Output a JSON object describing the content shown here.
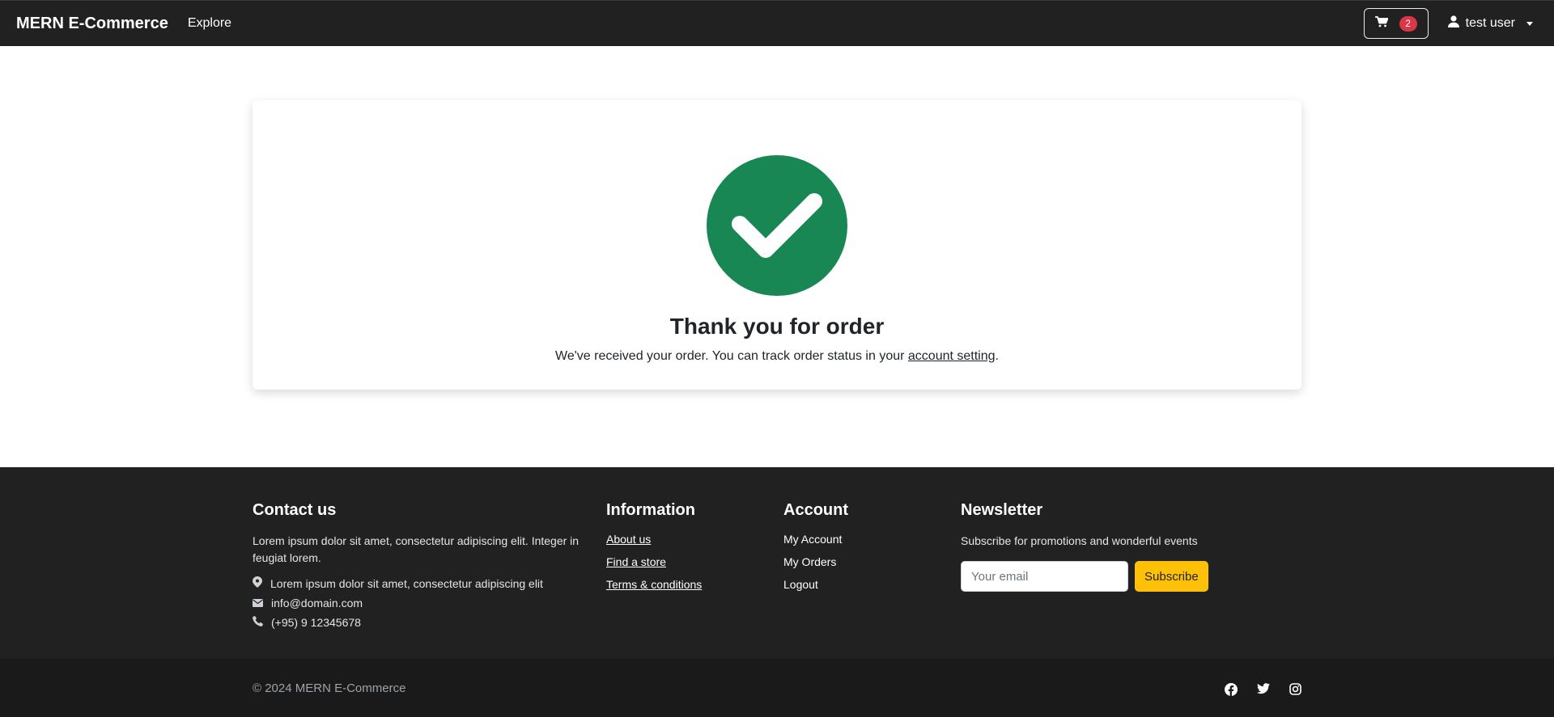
{
  "navbar": {
    "brand": "MERN E-Commerce",
    "explore": "Explore",
    "cart_count": "2",
    "user_name": "test user"
  },
  "confirmation": {
    "title": "Thank you for order",
    "message_prefix": "We've received your order. You can track order status in your ",
    "link_text": "account setting",
    "message_suffix": "."
  },
  "footer": {
    "contact": {
      "heading": "Contact us",
      "description": "Lorem ipsum dolor sit amet, consectetur adipiscing elit. Integer in feugiat lorem.",
      "address": "Lorem ipsum dolor sit amet, consectetur adipiscing elit",
      "email": "info@domain.com",
      "phone": "(+95) 9 12345678"
    },
    "information": {
      "heading": "Information",
      "links": [
        "About us",
        "Find a store",
        "Terms & conditions"
      ]
    },
    "account": {
      "heading": "Account",
      "links": [
        "My Account",
        "My Orders",
        "Logout"
      ]
    },
    "newsletter": {
      "heading": "Newsletter",
      "text": "Subscribe for promotions and wonderful events",
      "placeholder": "Your email",
      "button": "Subscribe"
    },
    "copyright": "© 2024 MERN E-Commerce"
  },
  "colors": {
    "navbar_bg": "#212121",
    "success": "#198754",
    "badge": "#dc3545",
    "subscribe": "#ffc107"
  },
  "icons": {
    "cart": "cart-icon",
    "user": "user-icon",
    "check": "check-icon",
    "location": "location-icon",
    "email": "envelope-icon",
    "phone": "phone-icon",
    "facebook": "facebook-icon",
    "twitter": "twitter-icon",
    "instagram": "instagram-icon"
  }
}
